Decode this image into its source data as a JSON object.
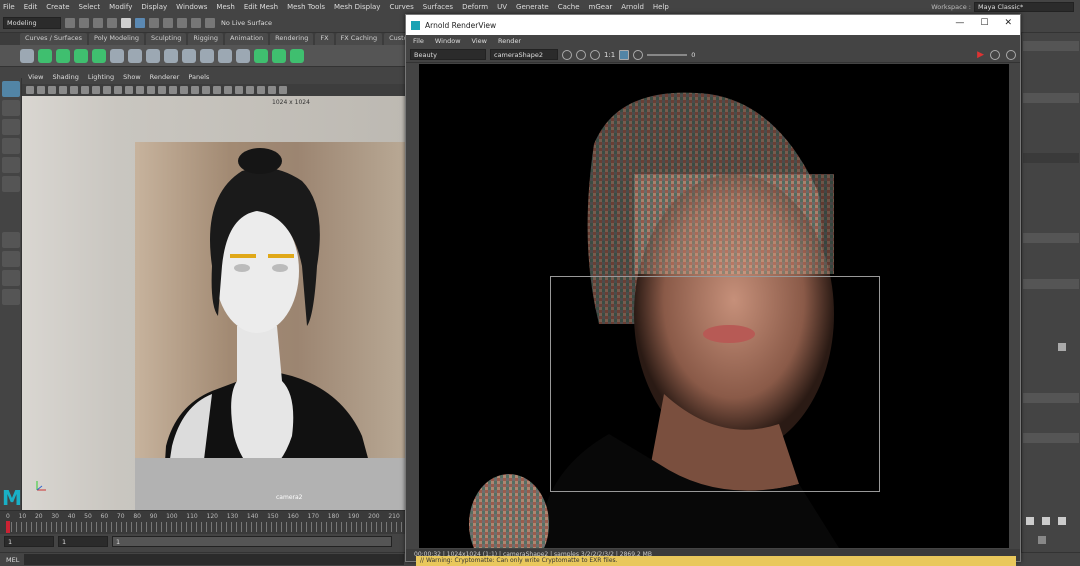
{
  "menubar": [
    "File",
    "Edit",
    "Create",
    "Select",
    "Modify",
    "Display",
    "Windows",
    "Mesh",
    "Edit Mesh",
    "Mesh Tools",
    "Mesh Display",
    "Curves",
    "Surfaces",
    "Deform",
    "UV",
    "Generate",
    "Cache",
    "mGear",
    "Arnold",
    "Help"
  ],
  "workspace": {
    "label": "Workspace :",
    "value": "Maya Classic*"
  },
  "status": {
    "mode": "Modeling",
    "live_surface": "No Live Surface"
  },
  "shelf_tabs": [
    "Curves / Surfaces",
    "Poly Modeling",
    "Sculpting",
    "Rigging",
    "Animation",
    "Rendering",
    "FX",
    "FX Caching",
    "Custom"
  ],
  "viewport": {
    "menu": [
      "View",
      "Shading",
      "Lighting",
      "Show",
      "Renderer",
      "Panels"
    ],
    "resolution": "1024 x 1024",
    "camera": "camera2"
  },
  "timeline": {
    "ticks": [
      "0",
      "10",
      "20",
      "30",
      "40",
      "50",
      "60",
      "70",
      "80",
      "90",
      "100",
      "110",
      "120",
      "130",
      "140",
      "150",
      "160",
      "170",
      "180",
      "190",
      "200",
      "210"
    ],
    "start": "1",
    "current": "1",
    "range_start": "1"
  },
  "cmd": {
    "label": "MEL",
    "warning": "// Warning: Cryptomatte: Can only write Cryptomatte to EXR files."
  },
  "arnold": {
    "title": "Arnold RenderView",
    "menu": [
      "File",
      "Window",
      "View",
      "Render"
    ],
    "aov": "Beauty",
    "camera": "cameraShape2",
    "ratio": "1:1",
    "exposure": "0",
    "status": "00:00:32 | 1024x1024 (1:1) | cameraShape2 | samples 3/2/2/2/3/2 | 2869.2 MB"
  },
  "colors": {
    "accent": "#5285a6",
    "maya_logo": "#19b0c6",
    "record": "#d33",
    "warning": "#e9c85c"
  }
}
